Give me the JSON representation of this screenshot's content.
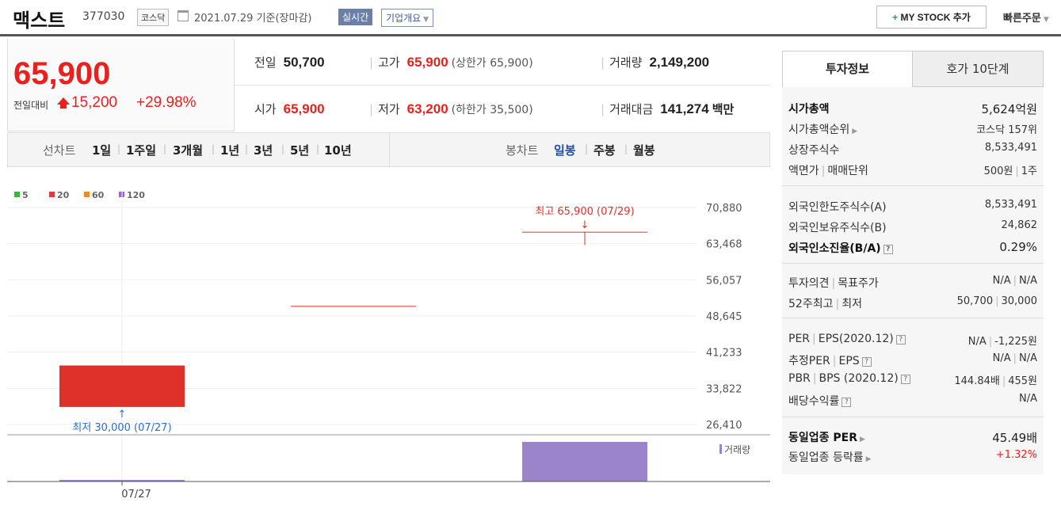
{
  "header": {
    "name": "맥스트",
    "code": "377030",
    "market": "코스닥",
    "date": "2021.07.29 기준(장마감)",
    "realtime": "실시간",
    "corp_info": "기업개요",
    "mystock": "MY STOCK 추가",
    "quick_order": "빠른주문"
  },
  "price": {
    "current": "65,900",
    "change_label": "전일대비",
    "change": "15,200",
    "change_pct": "+29.98%"
  },
  "stats": {
    "prev_label": "전일",
    "prev": "50,700",
    "high_label": "고가",
    "high": "65,900",
    "upper_limit": "(상한가 65,900)",
    "volume_label": "거래량",
    "volume": "2,149,200",
    "open_label": "시가",
    "open": "65,900",
    "low_label": "저가",
    "low": "63,200",
    "lower_limit": "(하한가 35,500)",
    "amount_label": "거래대금",
    "amount": "141,274",
    "amount_unit": "백만"
  },
  "periods": {
    "line_label": "선차트",
    "line_items": [
      "1일",
      "1주일",
      "3개월",
      "1년",
      "3년",
      "5년",
      "10년"
    ],
    "candle_label": "봉차트",
    "candle_items": [
      "일봉",
      "주봉",
      "월봉"
    ],
    "selected": "일봉"
  },
  "chart_data": {
    "type": "candlestick",
    "legend": [
      "5",
      "20",
      "60",
      "120"
    ],
    "legend_colors": [
      "#3cb33c",
      "#e03a3a",
      "#f08a24",
      "#9966cc"
    ],
    "y_ticks": [
      "70,880",
      "63,468",
      "56,057",
      "48,645",
      "41,233",
      "33,822",
      "26,410"
    ],
    "ylim": [
      26410,
      70880
    ],
    "x_label": "07/27",
    "candles": [
      {
        "open": 38500,
        "close": 30000,
        "high": 38500,
        "low": 30000,
        "color": "#e0302a"
      },
      {
        "open": 50700,
        "close": 50700,
        "high": 50700,
        "low": 50700,
        "color": "#e0302a"
      },
      {
        "open": 65900,
        "close": 65900,
        "high": 65900,
        "low": 63200,
        "color": "#e0302a"
      }
    ],
    "volume": [
      0.03,
      0,
      1.0
    ],
    "volume_color": "#9b84c9",
    "high_annotation": "최고 65,900 (07/29)",
    "low_annotation": "최저 30,000 (07/27)",
    "volume_label": "거래량"
  },
  "invest": {
    "tab1": "투자정보",
    "tab2": "호가 10단계",
    "market_cap_label": "시가총액",
    "market_cap": "5,624억원",
    "cap_rank_label": "시가총액순위",
    "cap_rank": "코스닥 157위",
    "shares_label": "상장주식수",
    "shares": "8,533,491",
    "face_label": "액면가",
    "unit_label": "매매단위",
    "face": "500원",
    "unit": "1주",
    "foreign_limit_label": "외국인한도주식수(A)",
    "foreign_limit": "8,533,491",
    "foreign_hold_label": "외국인보유주식수(B)",
    "foreign_hold": "24,862",
    "foreign_rate_label": "외국인소진율(B/A)",
    "foreign_rate": "0.29%",
    "opinion_label": "투자의견",
    "target_label": "목표주가",
    "opinion": "N/A",
    "target": "N/A",
    "w52_label": "52주최고",
    "low52_label": "최저",
    "high52": "50,700",
    "low52": "30,000",
    "per_label": "PER",
    "eps_label": "EPS(2020.12)",
    "per": "N/A",
    "eps": "-1,225원",
    "est_per_label": "추정PER",
    "est_eps_label": "EPS",
    "est_per": "N/A",
    "est_eps": "N/A",
    "pbr_label": "PBR",
    "bps_label": "BPS (2020.12)",
    "pbr": "144.84배",
    "bps": "455원",
    "div_label": "배당수익률",
    "div": "N/A",
    "ind_per_label": "동일업종 PER",
    "ind_per": "45.49배",
    "ind_rate_label": "동일업종 등락률",
    "ind_rate": "+1.32%"
  }
}
